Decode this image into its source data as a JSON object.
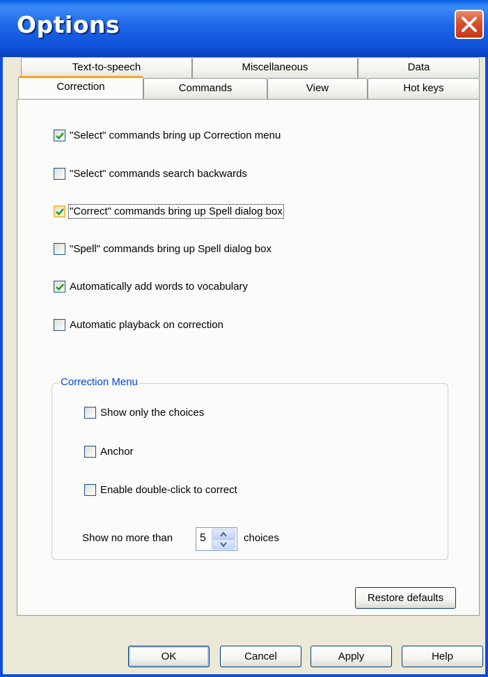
{
  "window": {
    "title": "Options"
  },
  "tabs_back": [
    "Text-to-speech",
    "Miscellaneous",
    "Data"
  ],
  "tabs_front": [
    "Correction",
    "Commands",
    "View",
    "Hot keys"
  ],
  "options": [
    {
      "label": "\"Select\" commands bring up Correction menu",
      "checked": true
    },
    {
      "label": "\"Select\" commands search backwards",
      "checked": false
    },
    {
      "label": "\"Correct\" commands bring up Spell dialog box",
      "checked": true
    },
    {
      "label": "\"Spell\" commands bring up Spell dialog box",
      "checked": false
    },
    {
      "label": "Automatically add words to vocabulary",
      "checked": true
    },
    {
      "label": "Automatic playback on correction",
      "checked": false
    }
  ],
  "correction_menu": {
    "legend": "Correction Menu",
    "options": [
      {
        "label": "Show only the choices",
        "checked": false
      },
      {
        "label": "Anchor",
        "checked": false
      },
      {
        "label": "Enable double-click to correct",
        "checked": false
      }
    ],
    "limit_label_prefix": "Show no more than",
    "limit_value": "5",
    "limit_label_suffix": "choices"
  },
  "buttons": {
    "restore": "Restore defaults",
    "ok": "OK",
    "cancel": "Cancel",
    "apply": "Apply",
    "help": "Help"
  },
  "colors": {
    "accent": "#0c4fd6",
    "check": "#21a121",
    "legend": "#0046d5",
    "tab_highlight": "#f5a623"
  }
}
